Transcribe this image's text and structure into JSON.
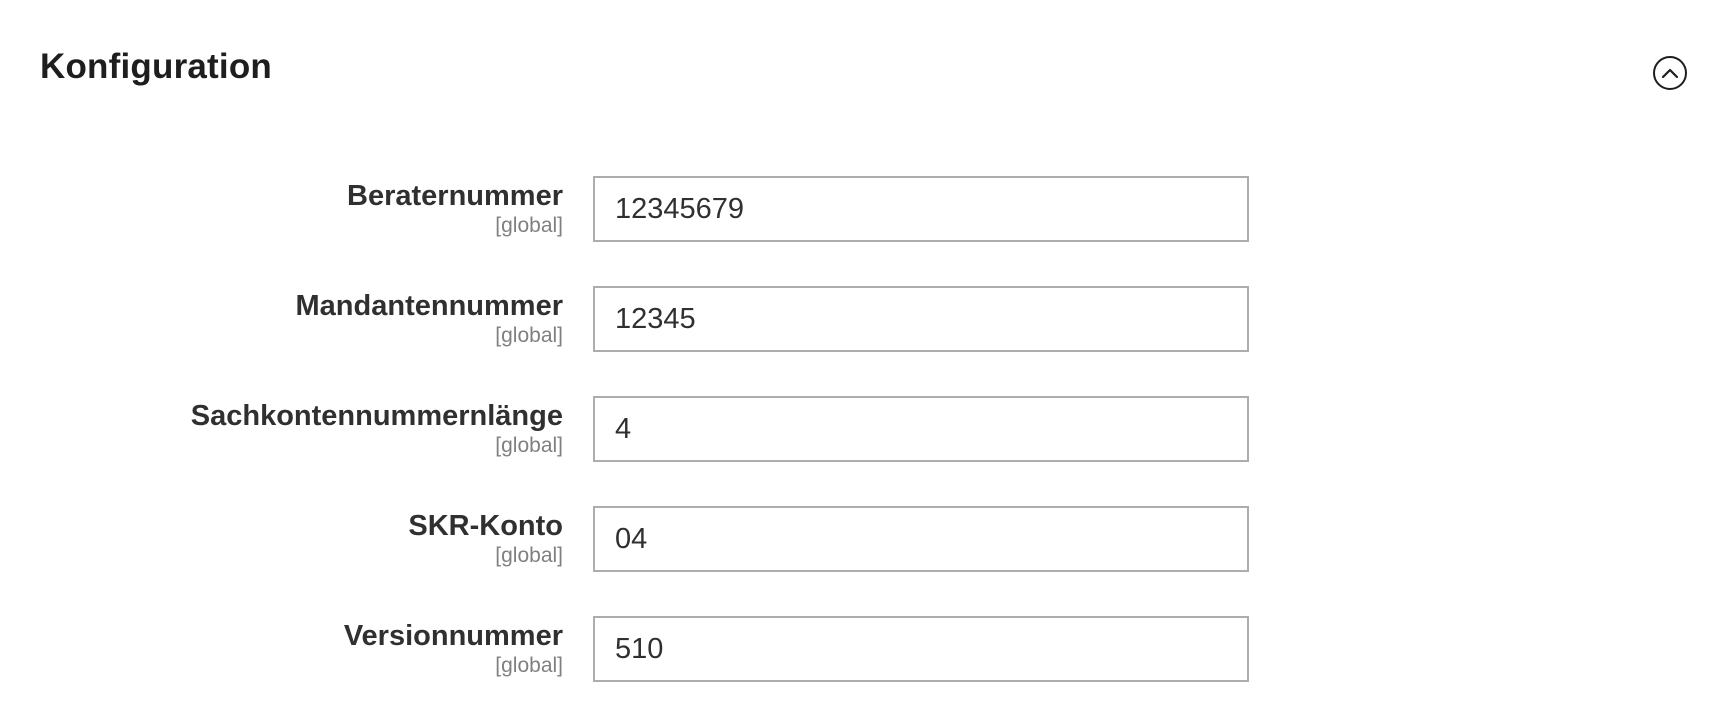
{
  "section": {
    "title": "Konfiguration",
    "toggle_icon": "chevron-up-circle-icon"
  },
  "fields": [
    {
      "label": "Beraternummer",
      "scope": "[global]",
      "value": "12345679"
    },
    {
      "label": "Mandantennummer",
      "scope": "[global]",
      "value": "12345"
    },
    {
      "label": "Sachkontennummernlänge",
      "scope": "[global]",
      "value": "4"
    },
    {
      "label": "SKR-Konto",
      "scope": "[global]",
      "value": "04"
    },
    {
      "label": "Versionnummer",
      "scope": "[global]",
      "value": "510"
    }
  ]
}
